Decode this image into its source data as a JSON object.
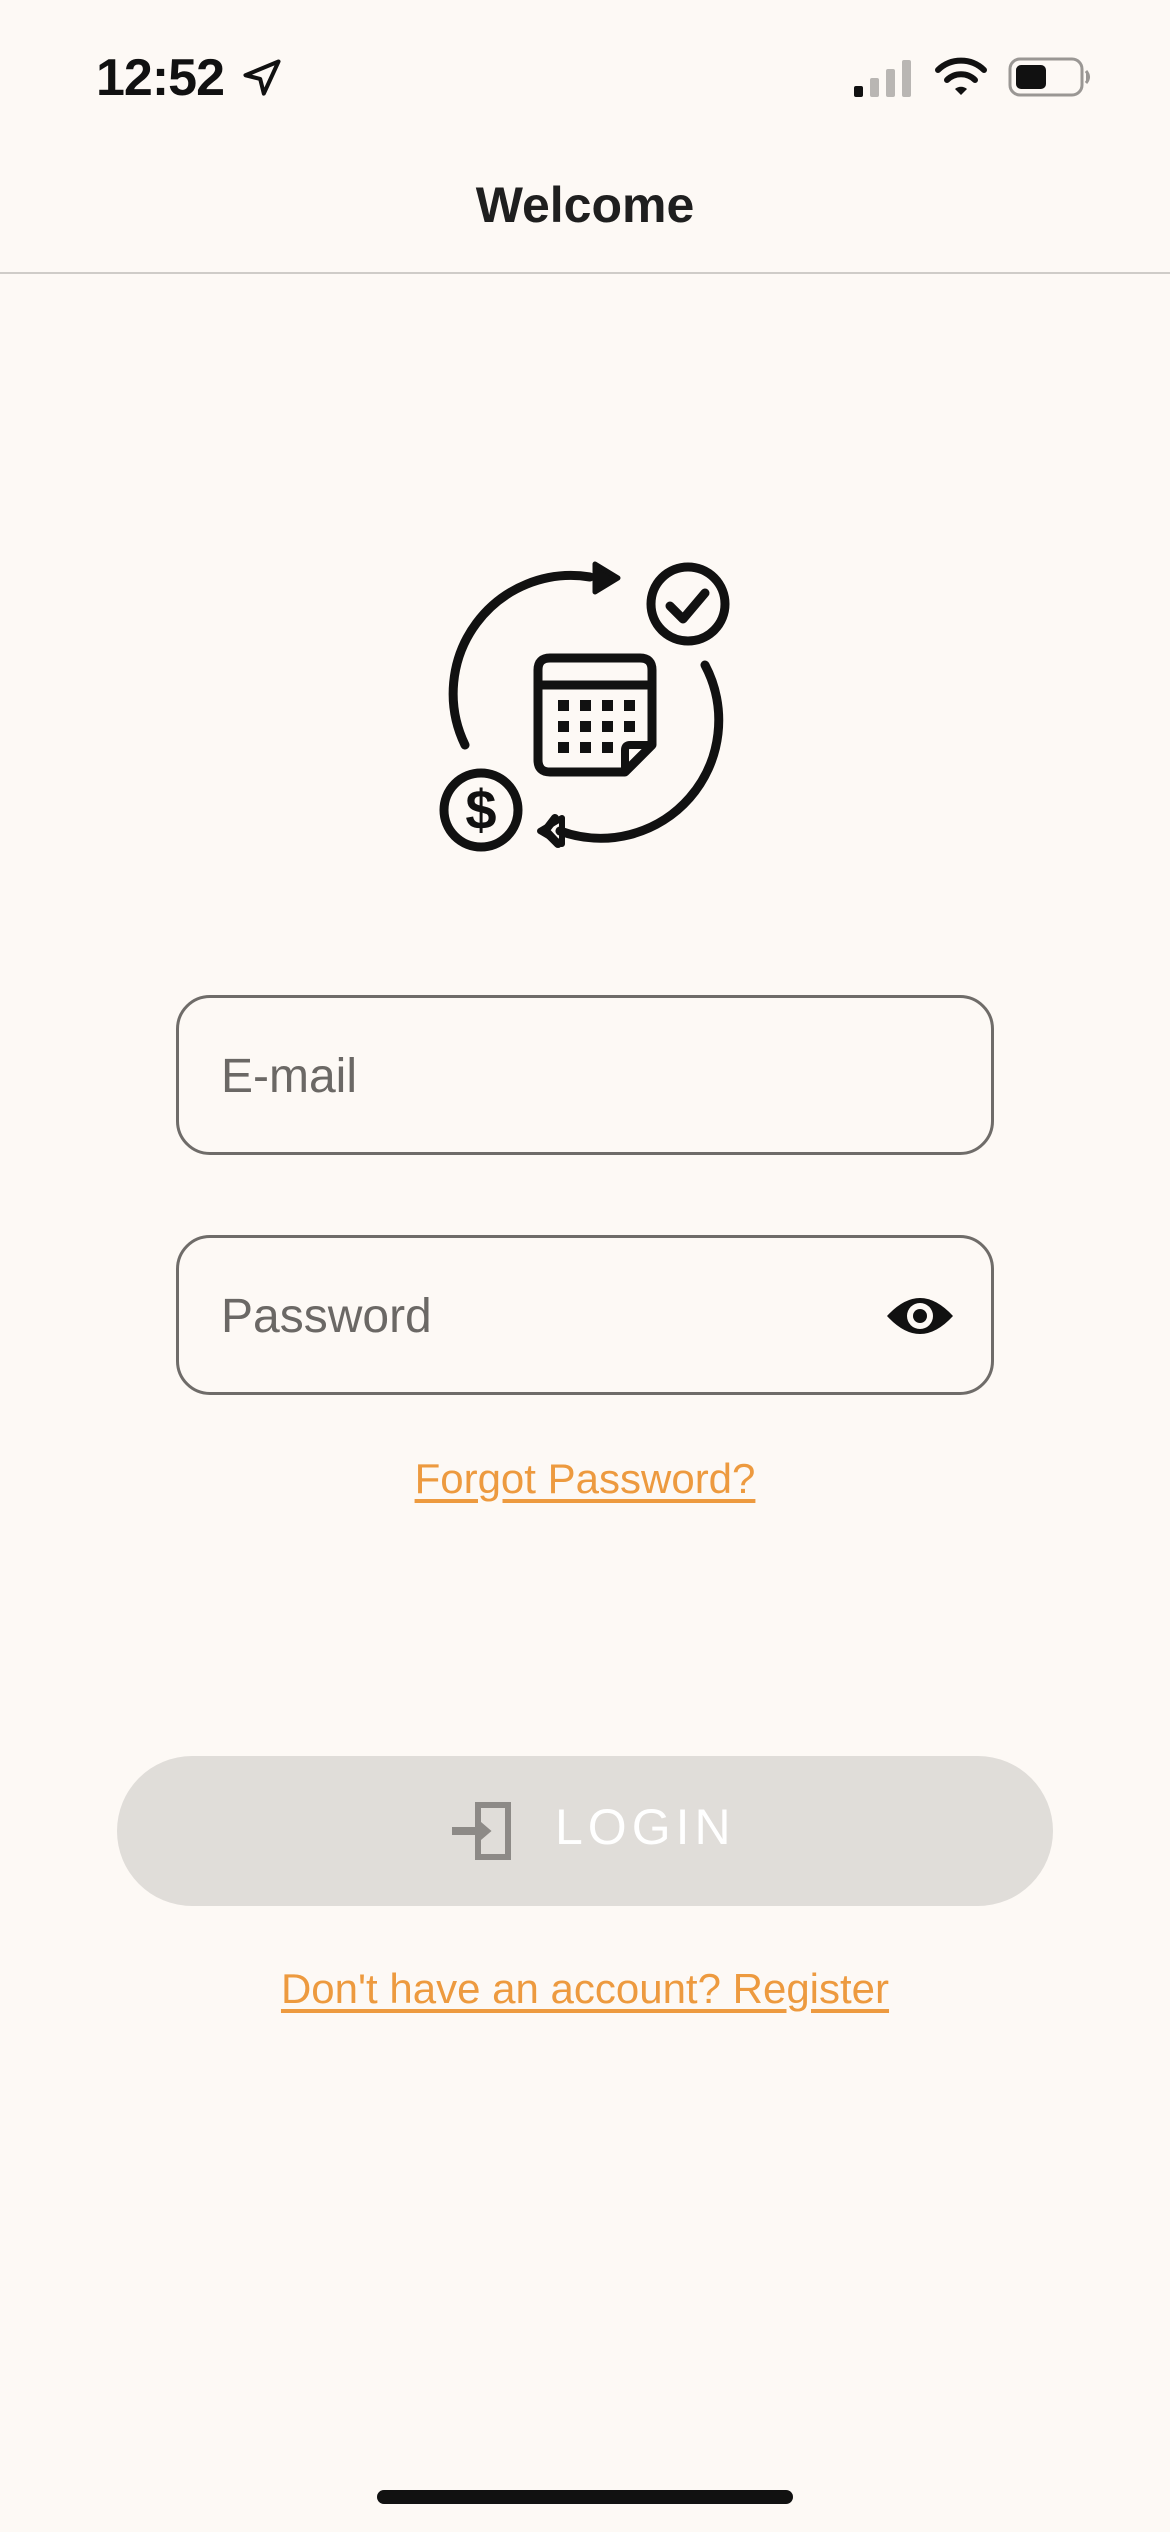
{
  "status_bar": {
    "time": "12:52",
    "icons": [
      "location-arrow-icon",
      "cellular-signal-icon",
      "wifi-icon",
      "battery-icon"
    ]
  },
  "header": {
    "title": "Welcome"
  },
  "logo": {
    "icon": "calendar-payment-cycle-icon"
  },
  "form": {
    "email_placeholder": "E-mail",
    "email_value": "",
    "password_placeholder": "Password",
    "password_value": "",
    "password_toggle_icon": "eye-icon",
    "forgot_password_label": "Forgot Password?",
    "login_label": "LOGIN",
    "login_icon": "login-enter-icon",
    "register_label": "Don't have an account? Register"
  },
  "colors": {
    "background": "#fdf9f5",
    "accent_link": "#ed9a3f",
    "button_disabled_bg": "#e0ddd9",
    "field_border": "#6f6c69"
  }
}
